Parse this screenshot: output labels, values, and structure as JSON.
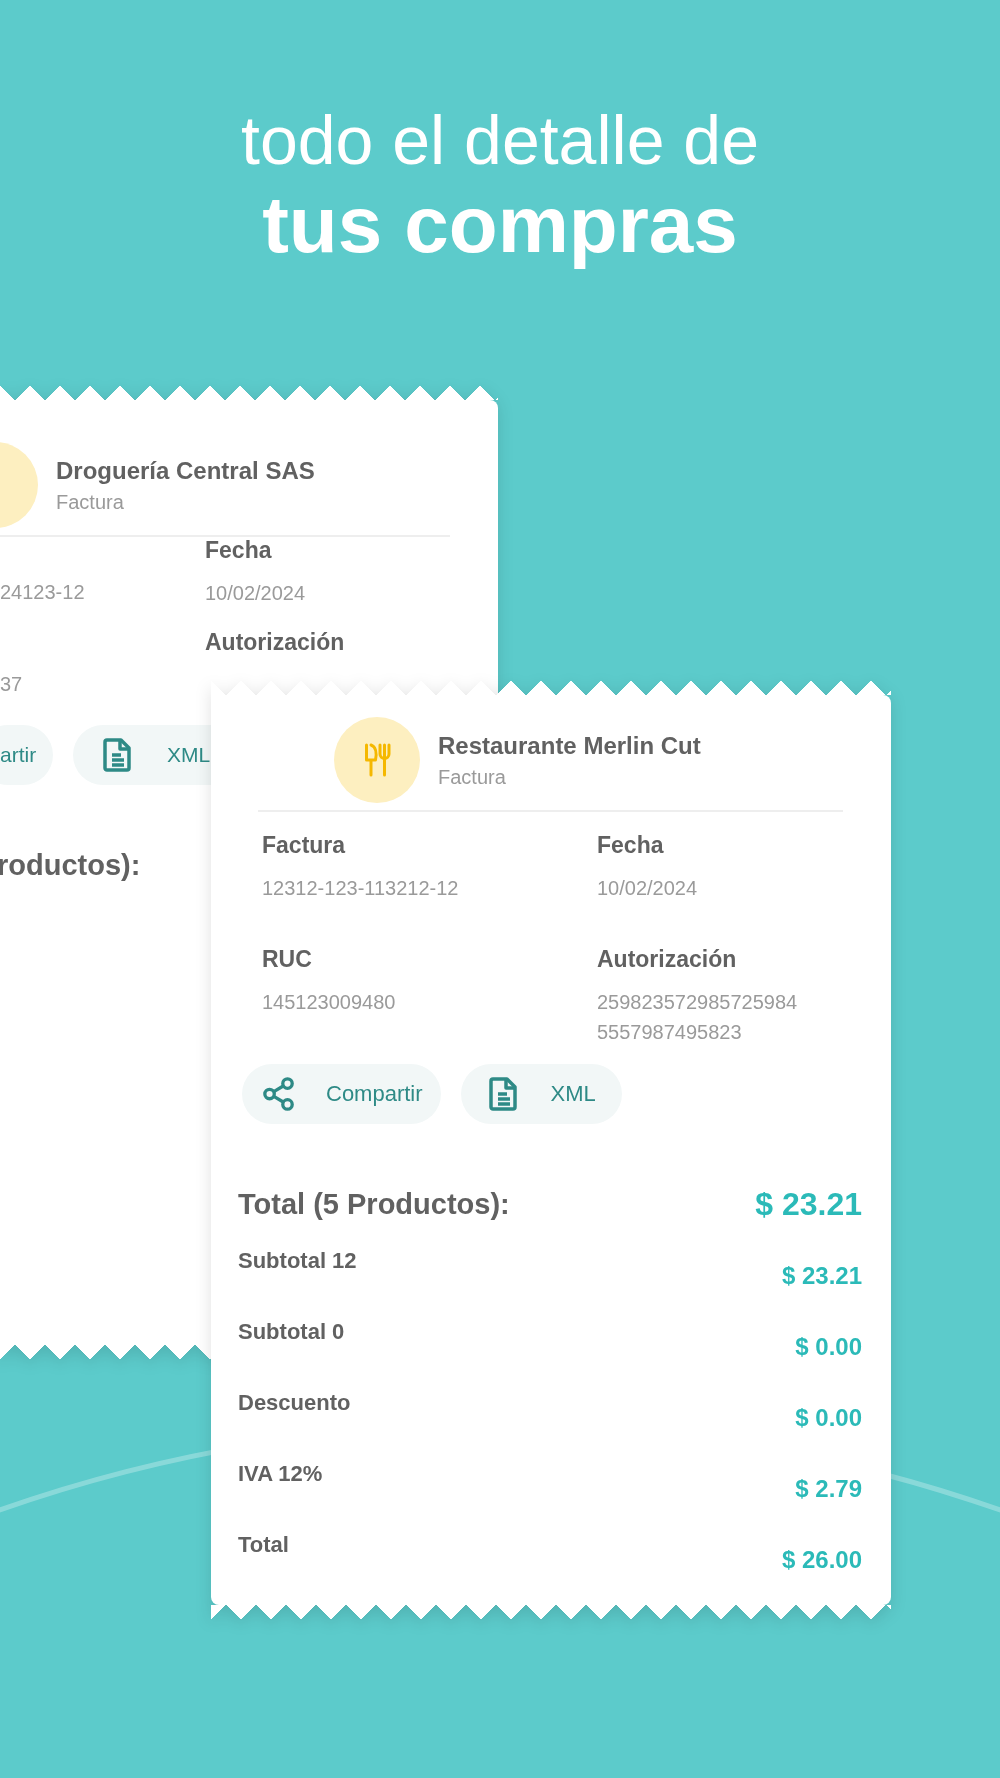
{
  "headline": {
    "line_1": "todo el detalle de",
    "line_2": "tus compras"
  },
  "receipts": [
    {
      "merchant": "Droguería Central SAS",
      "doc_type": "Factura",
      "fields": [
        {
          "value_lines": [
            "24123-12"
          ]
        },
        {
          "label": "Fecha",
          "value_lines": [
            "10/02/2024"
          ]
        },
        {
          "value_lines": [
            "37"
          ]
        },
        {
          "label": "Autorización"
        }
      ],
      "buttons": [
        {
          "label": "artir"
        },
        {
          "label": "XML",
          "kind": "file"
        }
      ],
      "total": {
        "label": "roductos):"
      }
    },
    {
      "merchant": "Restaurante Merlin Cut",
      "doc_type": "Factura",
      "avatar": {
        "kind": "restaurant"
      },
      "fields": [
        {
          "label": "Factura",
          "value_lines": [
            "12312-123-113212-12"
          ]
        },
        {
          "label": "Fecha",
          "value_lines": [
            "10/02/2024"
          ]
        },
        {
          "label": "RUC",
          "value_lines": [
            "145123009480"
          ]
        },
        {
          "label": "Autorización",
          "value_lines": [
            "259823572985725984",
            "5557987495823"
          ]
        }
      ],
      "buttons": [
        {
          "label": "Compartir",
          "kind": "share"
        },
        {
          "label": "XML",
          "kind": "file"
        }
      ],
      "total": {
        "label": "Total (5 Productos):",
        "amount": "$ 23.21"
      },
      "lines": [
        {
          "label": "Subtotal 12",
          "amount": "$ 23.21"
        },
        {
          "label": "Subtotal 0",
          "amount": "$ 0.00"
        },
        {
          "label": "Descuento",
          "amount": "$ 0.00"
        },
        {
          "label": "IVA 12%",
          "amount": "$ 2.79"
        },
        {
          "label": "Total",
          "amount": "$ 26.00"
        }
      ]
    }
  ]
}
